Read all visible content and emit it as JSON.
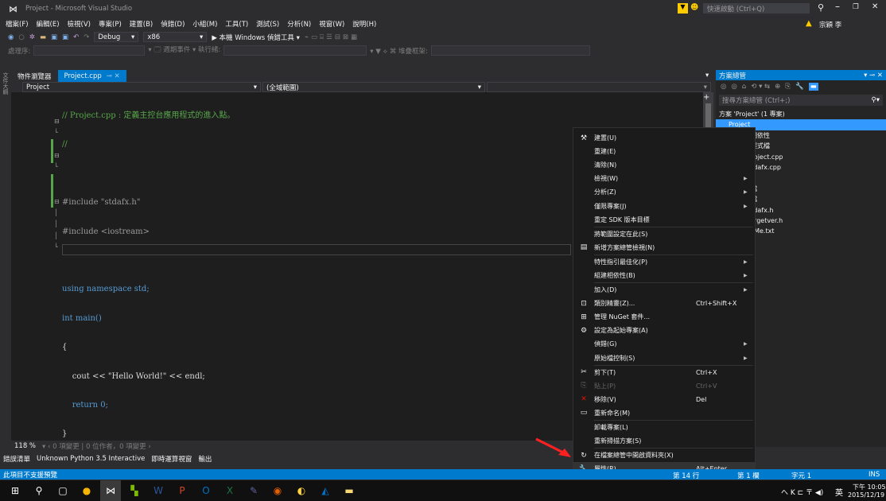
{
  "window": {
    "title": "Project - Microsoft Visual Studio",
    "quick_launch_placeholder": "快速啟動 (Ctrl+Q)",
    "user": "宗穎 李"
  },
  "menubar": [
    "檔案(F)",
    "編輯(E)",
    "檢視(V)",
    "專案(P)",
    "建置(B)",
    "偵錯(D)",
    "小組(M)",
    "工具(T)",
    "測試(S)",
    "分析(N)",
    "視窗(W)",
    "說明(H)"
  ],
  "toolbar": {
    "config": "Debug",
    "platform": "x86",
    "run_label": "▶ 本機 Windows 偵錯工具 ▾"
  },
  "toolbar2": {
    "process_label": "處理序:",
    "lifecycle_label": "▾ 🗔 週期事件 ▾ 執行緒:",
    "stack_label": "▾ ▼ ⟡ ⌘ 堆疊框架:"
  },
  "editor": {
    "left_strip_label": "文件大綱",
    "doc_tab_inactive": "物件瀏覽器",
    "doc_tab_active": "Project.cpp",
    "nav_project": "Project",
    "nav_scope": "(全域範圍)",
    "code_lines": [
      "// Project.cpp : 定義主控台應用程式的進入點。",
      "//",
      "",
      "#include \"stdafx.h\"",
      "#include <iostream>",
      "",
      "using namespace std;",
      "int main()",
      "{",
      "    cout << \"Hello World!\" << endl;",
      "    return 0;",
      "}"
    ],
    "zoom": "118 %",
    "changes": "▾ ‹ 0 項變更 | 0 位作者，0 項變更 ›"
  },
  "solution_explorer": {
    "title": "方案總管",
    "search_placeholder": "搜尋方案總管 (Ctrl+;)",
    "items": [
      {
        "label": "方案 'Project' (1 專案)",
        "indent": 0
      },
      {
        "label": "Project",
        "indent": 1,
        "selected": true
      },
      {
        "label": "外部相依性",
        "indent": 2
      },
      {
        "label": "原始程式檔",
        "indent": 2
      },
      {
        "label": "Project.cpp",
        "indent": 3
      },
      {
        "label": "stdafx.cpp",
        "indent": 3
      },
      {
        "label": "參考",
        "indent": 2
      },
      {
        "label": "資源檔",
        "indent": 2
      },
      {
        "label": "標頭檔",
        "indent": 2
      },
      {
        "label": "stdafx.h",
        "indent": 3
      },
      {
        "label": "targetver.h",
        "indent": 3
      },
      {
        "label": "ReadMe.txt",
        "indent": 2
      }
    ]
  },
  "context_menu": [
    {
      "icon": "⚒",
      "label": "建置(U)"
    },
    {
      "label": "重建(E)"
    },
    {
      "label": "清除(N)"
    },
    {
      "label": "檢視(W)",
      "submenu": true
    },
    {
      "label": "分析(Z)",
      "submenu": true
    },
    {
      "label": "僅限專案(J)",
      "submenu": true
    },
    {
      "label": "重定 SDK 版本目標"
    },
    {
      "sep": true
    },
    {
      "label": "將範圍設定在此(S)"
    },
    {
      "icon": "▤",
      "label": "新增方案總管檢視(N)"
    },
    {
      "sep": true
    },
    {
      "label": "特性指引最佳化(P)",
      "submenu": true
    },
    {
      "label": "組建相依性(B)",
      "submenu": true
    },
    {
      "sep": true
    },
    {
      "label": "加入(D)",
      "submenu": true
    },
    {
      "icon": "⊡",
      "label": "類別精靈(Z)...",
      "shortcut": "Ctrl+Shift+X"
    },
    {
      "icon": "⊞",
      "label": "管理 NuGet 套件..."
    },
    {
      "icon": "⚙",
      "label": "設定為起始專案(A)"
    },
    {
      "label": "偵錯(G)",
      "submenu": true
    },
    {
      "label": "原始檔控制(S)",
      "submenu": true
    },
    {
      "sep": true
    },
    {
      "icon": "✂",
      "label": "剪下(T)",
      "shortcut": "Ctrl+X"
    },
    {
      "icon": "⎘",
      "label": "貼上(P)",
      "shortcut": "Ctrl+V",
      "disabled": true
    },
    {
      "icon": "✕",
      "label": "移除(V)",
      "shortcut": "Del",
      "red": true
    },
    {
      "icon": "▭",
      "label": "重新命名(M)"
    },
    {
      "sep": true
    },
    {
      "label": "卸載專案(L)"
    },
    {
      "label": "重新掃描方案(S)"
    },
    {
      "sep": true
    },
    {
      "icon": "↻",
      "label": "在檔案總管中開啟資料夾(X)"
    },
    {
      "icon": "🔧",
      "label": "屬性(R)",
      "shortcut": "Alt+Enter",
      "selected": true
    }
  ],
  "bottom_tabs": [
    "錯誤清單",
    "Unknown Python 3.5 Interactive",
    "即時運算視窗",
    "輸出"
  ],
  "status": {
    "left": "此項目不支援預覽",
    "line": "第 14 行",
    "col": "第 1 欄",
    "ch": "字元 1",
    "mode": "INS"
  },
  "taskbar": {
    "time": "下午 10:05",
    "date": "2015/12/19",
    "ime": "英",
    "tray": "へ K ⊏ 〒 ◀)"
  },
  "colors": {
    "accent": "#007acc",
    "keyword": "#569cd6",
    "string": "#d69d85",
    "comment": "#57a64a",
    "text": "#dcdcdc"
  }
}
